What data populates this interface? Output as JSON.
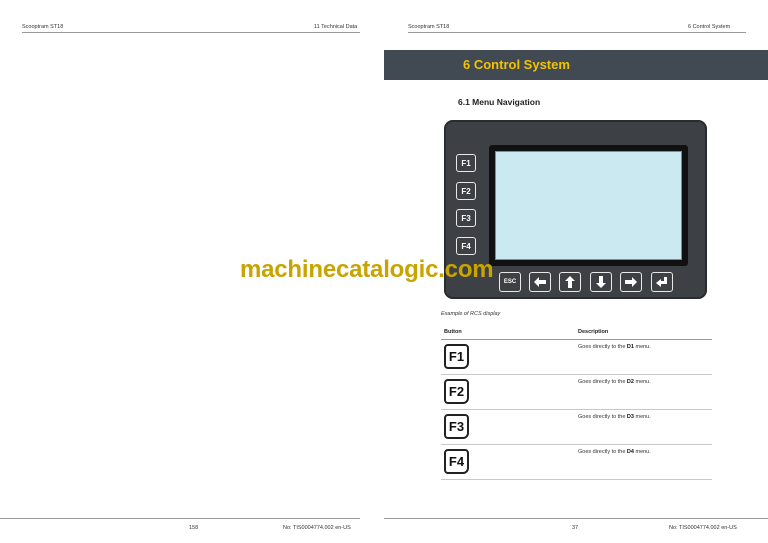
{
  "left_page": {
    "header_left": "Scooptram ST18",
    "header_right": "11 Technical Data",
    "page_number": "158",
    "doc_number": "No: TIS0004774.002 en-US"
  },
  "right_page": {
    "header_left": "Scooptram ST18",
    "header_right": "6 Control System",
    "chapter_title": "6  Control System",
    "section_title": "6.1  Menu Navigation",
    "caption": "Example of RCS display",
    "page_number": "37",
    "doc_number": "No: TIS0004774.002 en-US"
  },
  "device": {
    "function_keys": [
      "F1",
      "F2",
      "F3",
      "F4"
    ],
    "esc_label": "ESC",
    "nav_keys": [
      "arrow-left-icon",
      "arrow-up-icon",
      "arrow-down-icon",
      "arrow-right-icon",
      "enter-icon"
    ]
  },
  "watermark": "machinecatalogic.com",
  "table": {
    "col_button": "Button",
    "col_description": "Description",
    "rows": [
      {
        "key": "F1",
        "desc_pre": "Goes directly to the ",
        "desc_bold": "D1",
        "desc_post": " menu."
      },
      {
        "key": "F2",
        "desc_pre": "Goes directly to the ",
        "desc_bold": "D2",
        "desc_post": " menu."
      },
      {
        "key": "F3",
        "desc_pre": "Goes directly to the ",
        "desc_bold": "D3",
        "desc_post": " menu."
      },
      {
        "key": "F4",
        "desc_pre": "Goes directly to the ",
        "desc_bold": "D4",
        "desc_post": " menu."
      }
    ]
  },
  "colors": {
    "banner": "#414a52",
    "banner_text": "#f2c300",
    "screen": "#cbe9f1",
    "watermark": "#c9a400"
  }
}
